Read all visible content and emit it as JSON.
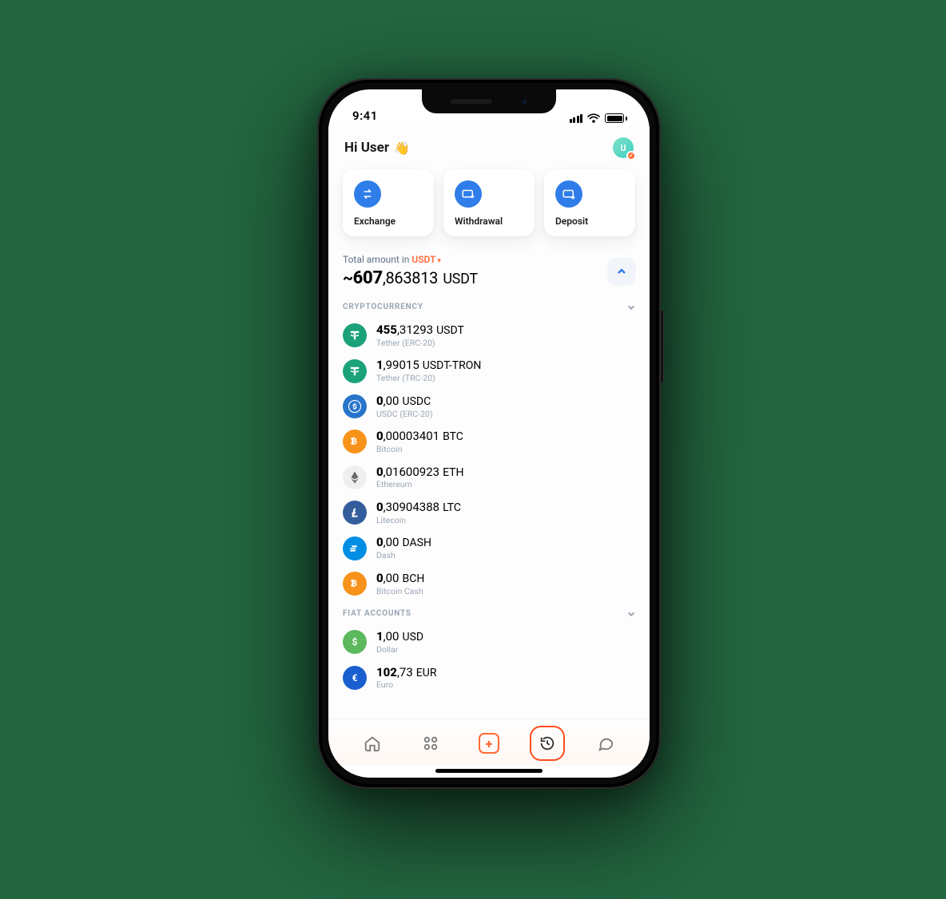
{
  "status": {
    "time": "9:41"
  },
  "header": {
    "greeting": "Hi User",
    "wave_emoji": "👋",
    "avatar_initial": "U"
  },
  "actions": {
    "exchange": "Exchange",
    "withdrawal": "Withdrawal",
    "deposit": "Deposit"
  },
  "total": {
    "caption_prefix": "Total amount in ",
    "currency": "USDT",
    "approx": "~",
    "pre": "607",
    "sep": ",",
    "post": "863813",
    "unit": "USDT"
  },
  "sections": {
    "crypto_title": "CRYPTOCURRENCY",
    "fiat_title": "FIAT ACCOUNTS"
  },
  "coins": {
    "colors": {
      "usdt": "#1ba27a",
      "usdc": "#2775ca",
      "btc": "#f7931a",
      "eth": "#d8d8d8",
      "ltc": "#345d9d",
      "dash": "#008de4",
      "bch": "#f7931a",
      "usd": "#5cb85c",
      "eur": "#1a5fd0"
    }
  },
  "crypto": [
    {
      "id": "usdt",
      "pre": "455",
      "sep": ",",
      "post": "31293",
      "sym": "USDT",
      "sub": "Tether (ERC-20)"
    },
    {
      "id": "usdt2",
      "pre": "1",
      "sep": ",",
      "post": "99015",
      "sym": "USDT-TRON",
      "sub": "Tether (TRC-20)"
    },
    {
      "id": "usdc",
      "pre": "0",
      "sep": ",",
      "post": "00",
      "sym": "USDC",
      "sub": "USDC (ERC-20)"
    },
    {
      "id": "btc",
      "pre": "0",
      "sep": ",",
      "post": "00003401",
      "sym": "BTC",
      "sub": "Bitcoin"
    },
    {
      "id": "eth",
      "pre": "0",
      "sep": ",",
      "post": "01600923",
      "sym": "ETH",
      "sub": "Ethereum"
    },
    {
      "id": "ltc",
      "pre": "0",
      "sep": ",",
      "post": "30904388",
      "sym": "LTC",
      "sub": "Litecoin"
    },
    {
      "id": "dash",
      "pre": "0",
      "sep": ",",
      "post": "00",
      "sym": "DASH",
      "sub": "Dash"
    },
    {
      "id": "bch",
      "pre": "0",
      "sep": ",",
      "post": "00",
      "sym": "BCH",
      "sub": "Bitcoin Cash"
    }
  ],
  "fiat": [
    {
      "id": "usd",
      "pre": "1",
      "sep": ",",
      "post": "00",
      "sym": "USD",
      "sub": "Dollar"
    },
    {
      "id": "eur",
      "pre": "102",
      "sep": ",",
      "post": "73",
      "sym": "EUR",
      "sub": "Euro"
    }
  ]
}
